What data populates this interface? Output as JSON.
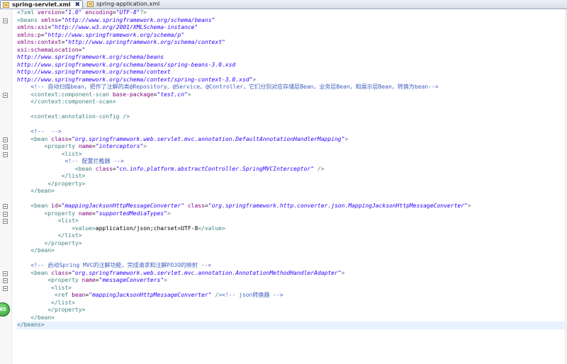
{
  "tabs": [
    {
      "label": "spring-servlet.xml",
      "active": true,
      "close": "✖"
    },
    {
      "label": "spring-application.xml",
      "active": false
    }
  ],
  "badge": "45",
  "colors": {
    "tag": "#3f7f7f",
    "attribute": "#7f007f",
    "value": "#2a00ff",
    "comment": "#3f5fbf",
    "text": "#000000",
    "current_line": "#e8f2fe"
  },
  "lines": [
    [
      [
        "tg",
        "<?xml "
      ],
      [
        "at",
        "version"
      ],
      [
        "tx",
        "="
      ],
      [
        "av",
        "\"1.0\""
      ],
      [
        "tx",
        " "
      ],
      [
        "at",
        "encoding"
      ],
      [
        "tx",
        "="
      ],
      [
        "av",
        "\"UTF-8\""
      ],
      [
        "tg",
        "?>"
      ]
    ],
    [
      [
        "tg",
        "<beans "
      ],
      [
        "at",
        "xmlns"
      ],
      [
        "tx",
        "="
      ],
      [
        "av",
        "\"http://www.springframework.org/schema/beans\""
      ]
    ],
    [
      [
        "at",
        "xmlns:xsi"
      ],
      [
        "tx",
        "="
      ],
      [
        "av",
        "\"http://www.w3.org/2001/XMLSchema-instance\""
      ]
    ],
    [
      [
        "at",
        "xmlns:p"
      ],
      [
        "tx",
        "="
      ],
      [
        "av",
        "\"http://www.springframework.org/schema/p\""
      ]
    ],
    [
      [
        "at",
        "xmlns:context"
      ],
      [
        "tx",
        "="
      ],
      [
        "av",
        "\"http://www.springframework.org/schema/context\""
      ]
    ],
    [
      [
        "at",
        "xsi:schemaLocation"
      ],
      [
        "tx",
        "="
      ],
      [
        "av",
        "\""
      ]
    ],
    [
      [
        "av",
        "http://www.springframework.org/schema/beans"
      ]
    ],
    [
      [
        "av",
        "http://www.springframework.org/schema/beans/spring-beans-3.0.xsd"
      ]
    ],
    [
      [
        "av",
        "http://www.springframework.org/schema/context"
      ]
    ],
    [
      [
        "av",
        "http://www.springframework.org/schema/context/spring-context-3.0.xsd\""
      ],
      [
        "tg",
        ">"
      ]
    ],
    [
      [
        "tx",
        "    "
      ],
      [
        "cm",
        "<!-- 自动扫描bean，把作了注解的类@Repository、@Service、@Controller，它们分别对应存储层Bean，业务层Bean，和展示层Bean，转换为bean-->"
      ]
    ],
    [
      [
        "tx",
        "    "
      ],
      [
        "tg",
        "<context:component-scan "
      ],
      [
        "at",
        "base-package"
      ],
      [
        "tx",
        "="
      ],
      [
        "av",
        "\"test.cn\""
      ],
      [
        "tg",
        ">"
      ]
    ],
    [
      [
        "tx",
        "    "
      ],
      [
        "tg",
        "</context:component-scan>"
      ]
    ],
    [
      [
        "tx",
        ""
      ]
    ],
    [
      [
        "tx",
        "    "
      ],
      [
        "tg",
        "<context:annotation-config />"
      ]
    ],
    [
      [
        "tx",
        ""
      ]
    ],
    [
      [
        "tx",
        "    "
      ],
      [
        "cm",
        "<!--  -->"
      ]
    ],
    [
      [
        "tx",
        "    "
      ],
      [
        "tg",
        "<bean "
      ],
      [
        "at",
        "class"
      ],
      [
        "tx",
        "="
      ],
      [
        "av",
        "\"org.springframework.web.servlet.mvc.annotation.DefaultAnnotationHandlerMapping\""
      ],
      [
        "tg",
        ">"
      ]
    ],
    [
      [
        "tx",
        "        "
      ],
      [
        "tg",
        "<property "
      ],
      [
        "at",
        "name"
      ],
      [
        "tx",
        "="
      ],
      [
        "av",
        "\"interceptors\""
      ],
      [
        "tg",
        ">"
      ]
    ],
    [
      [
        "tx",
        "             "
      ],
      [
        "tg",
        "<list>"
      ]
    ],
    [
      [
        "tx",
        "              "
      ],
      [
        "cm",
        "<!-- 配置拦截器 -->"
      ]
    ],
    [
      [
        "tx",
        "                 "
      ],
      [
        "tg",
        "<bean "
      ],
      [
        "at",
        "class"
      ],
      [
        "tx",
        "="
      ],
      [
        "av",
        "\"cn.info.platform.abstractController.SpringMVCInterceptor\""
      ],
      [
        "tg",
        " />"
      ]
    ],
    [
      [
        "tx",
        "             "
      ],
      [
        "tg",
        "</list>"
      ]
    ],
    [
      [
        "tx",
        "         "
      ],
      [
        "tg",
        "</property>"
      ]
    ],
    [
      [
        "tx",
        "    "
      ],
      [
        "tg",
        "</bean>"
      ]
    ],
    [
      [
        "tx",
        ""
      ]
    ],
    [
      [
        "tx",
        "    "
      ],
      [
        "tg",
        "<bean "
      ],
      [
        "at",
        "id"
      ],
      [
        "tx",
        "="
      ],
      [
        "av",
        "\"mappingJacksonHttpMessageConverter\""
      ],
      [
        "tx",
        " "
      ],
      [
        "at",
        "class"
      ],
      [
        "tx",
        "="
      ],
      [
        "av",
        "\"org.springframework.http.converter.json.MappingJacksonHttpMessageConverter\""
      ],
      [
        "tg",
        ">"
      ]
    ],
    [
      [
        "tx",
        "        "
      ],
      [
        "tg",
        "<property "
      ],
      [
        "at",
        "name"
      ],
      [
        "tx",
        "="
      ],
      [
        "av",
        "\"supportedMediaTypes\""
      ],
      [
        "tg",
        ">"
      ]
    ],
    [
      [
        "tx",
        "            "
      ],
      [
        "tg",
        "<list>"
      ]
    ],
    [
      [
        "tx",
        "                "
      ],
      [
        "tg",
        "<value>"
      ],
      [
        "tx",
        "application/json;charset=UTF-8"
      ],
      [
        "tg",
        "</value>"
      ]
    ],
    [
      [
        "tx",
        "            "
      ],
      [
        "tg",
        "</list>"
      ]
    ],
    [
      [
        "tx",
        "        "
      ],
      [
        "tg",
        "</property>"
      ]
    ],
    [
      [
        "tx",
        "    "
      ],
      [
        "tg",
        "</bean>"
      ]
    ],
    [
      [
        "tx",
        ""
      ]
    ],
    [
      [
        "tx",
        "    "
      ],
      [
        "cm",
        "<!-- 启动Spring MVC的注解功能，完成请求和注解POJO的映射 -->"
      ]
    ],
    [
      [
        "tx",
        "    "
      ],
      [
        "tg",
        "<bean "
      ],
      [
        "at",
        "class"
      ],
      [
        "tx",
        "="
      ],
      [
        "av",
        "\"org.springframework.web.servlet.mvc.annotation.AnnotationMethodHandlerAdapter\""
      ],
      [
        "tg",
        ">"
      ]
    ],
    [
      [
        "tx",
        "         "
      ],
      [
        "tg",
        "<property "
      ],
      [
        "at",
        "name"
      ],
      [
        "tx",
        "="
      ],
      [
        "av",
        "\"messageConverters\""
      ],
      [
        "tg",
        ">"
      ]
    ],
    [
      [
        "tx",
        "          "
      ],
      [
        "tg",
        "<list>"
      ]
    ],
    [
      [
        "tx",
        "           "
      ],
      [
        "tg",
        "<ref "
      ],
      [
        "at",
        "bean"
      ],
      [
        "tx",
        "="
      ],
      [
        "av",
        "\"mappingJacksonHttpMessageConverter\""
      ],
      [
        "tg",
        " />"
      ],
      [
        "cm",
        "<!-- json转换器 -->"
      ]
    ],
    [
      [
        "tx",
        "          "
      ],
      [
        "tg",
        "</list>"
      ]
    ],
    [
      [
        "tx",
        "         "
      ],
      [
        "tg",
        "</property>"
      ]
    ],
    [
      [
        "tx",
        "    "
      ],
      [
        "tg",
        "</bean>"
      ]
    ],
    [
      [
        "tg",
        "</beans>"
      ]
    ]
  ],
  "folds": [
    1,
    11,
    17,
    18,
    19,
    26,
    27,
    28,
    35,
    36,
    37
  ]
}
